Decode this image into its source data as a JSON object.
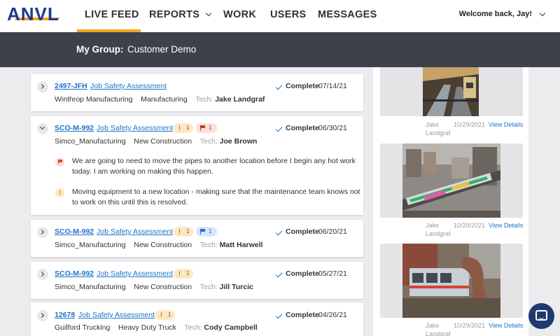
{
  "brand": {
    "logo_text": "ANVL",
    "colors": {
      "primary": "#1f3a8f",
      "accent": "#f2a71b",
      "link": "#1e73c8"
    }
  },
  "nav": {
    "items": [
      {
        "label": "LIVE FEED",
        "active": true
      },
      {
        "label": "REPORTS",
        "has_dropdown": true
      },
      {
        "label": "WORK"
      },
      {
        "label": "USERS"
      },
      {
        "label": "MESSAGES"
      }
    ],
    "welcome": "Welcome back, Jay!"
  },
  "group": {
    "label": "My Group:",
    "value": "Customer Demo"
  },
  "feed": [
    {
      "id": "2497-JFH",
      "type": "Job Safety Assessment",
      "badges": [],
      "status": "Complete",
      "date": "07/14/21",
      "company": "Winthrop Manufacturing",
      "category": "Manufacturing",
      "tech_label": "Tech:",
      "tech": "Jake Landgraf",
      "expanded": false
    },
    {
      "id": "SCO-M-992",
      "type": "Job Safety Assessment",
      "badges": [
        {
          "kind": "warning",
          "icon": "!",
          "count": "1"
        },
        {
          "kind": "flag-red",
          "count": "1"
        }
      ],
      "status": "Complete",
      "date": "06/30/21",
      "company": "Simco_Manufacturing",
      "category": "New Construction",
      "tech_label": "Tech:",
      "tech": "Joe Brown",
      "expanded": true,
      "notes": [
        {
          "kind": "flag-red",
          "text": "We are going to need to move the pipes to another location before I begin any hot work today. I am working on making this happen."
        },
        {
          "kind": "warning",
          "icon": "!",
          "text": "Moving equipment to a new location - making sure that the maintenance team knows not to work on this until this is resolved."
        }
      ]
    },
    {
      "id": "SCO-M-992",
      "type": "Job Safety Assessment",
      "badges": [
        {
          "kind": "warning",
          "icon": "!",
          "count": "1"
        },
        {
          "kind": "flag-blue",
          "count": "1"
        }
      ],
      "status": "Complete",
      "date": "06/20/21",
      "company": "Simco_Manufacturing",
      "category": "New Construction",
      "tech_label": "Tech:",
      "tech": "Matt Harwell",
      "expanded": false
    },
    {
      "id": "SCO-M-992",
      "type": "Job Safety Assessment",
      "badges": [
        {
          "kind": "warning",
          "icon": "!",
          "count": "1"
        }
      ],
      "status": "Complete",
      "date": "05/27/21",
      "company": "Simco_Manufacturing",
      "category": "New Construction",
      "tech_label": "Tech:",
      "tech": "Jill Turcic",
      "expanded": false
    },
    {
      "id": "12678",
      "type": "Job Safety Assessment",
      "badges": [
        {
          "kind": "warning",
          "icon": "!",
          "count": "1"
        }
      ],
      "status": "Complete",
      "date": "04/26/21",
      "company": "Guilford Trucking",
      "category": "Heavy Duty Truck",
      "tech_label": "Tech:",
      "tech": "Cody Campbell",
      "expanded": false
    }
  ],
  "photos": [
    {
      "tech_line1": "Jake",
      "tech_line2": "Landgraf",
      "date": "10/29/2021",
      "link": "View Details"
    },
    {
      "tech_line1": "Jake",
      "tech_line2": "Landgraf",
      "date": "10/29/2021",
      "link": "View Details"
    },
    {
      "tech_line1": "Jake",
      "tech_line2": "Landgraf",
      "date": "10/29/2021",
      "link": "View Details"
    }
  ]
}
